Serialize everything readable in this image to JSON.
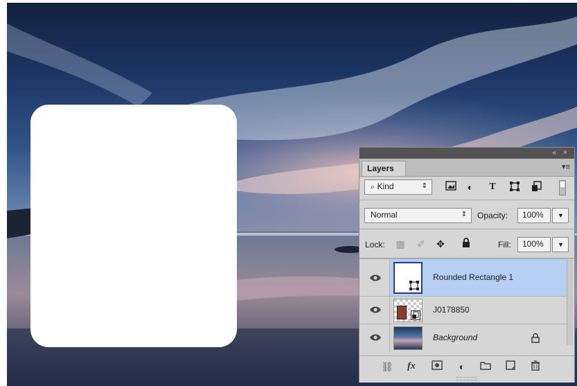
{
  "layers_panel": {
    "collapse_glyph": "«",
    "close_glyph": "×",
    "tab_label": "Layers",
    "menu_icon": "panel-menu-icon",
    "filter": {
      "search_icon": "search-icon",
      "kind_label": "Kind"
    },
    "blend_mode": "Normal",
    "opacity_label": "Opacity:",
    "opacity_value": "100%",
    "lock_label": "Lock:",
    "fill_label": "Fill:",
    "fill_value": "100%",
    "layers": [
      {
        "name": "Rounded Rectangle 1",
        "selected": true
      },
      {
        "name": "J0178850",
        "selected": false
      },
      {
        "name": "Background",
        "selected": false,
        "locked": true
      }
    ]
  },
  "colors": {
    "selected_layer": "#b6d0f5",
    "panel": "#d6d6d6",
    "topbar": "#535353"
  }
}
